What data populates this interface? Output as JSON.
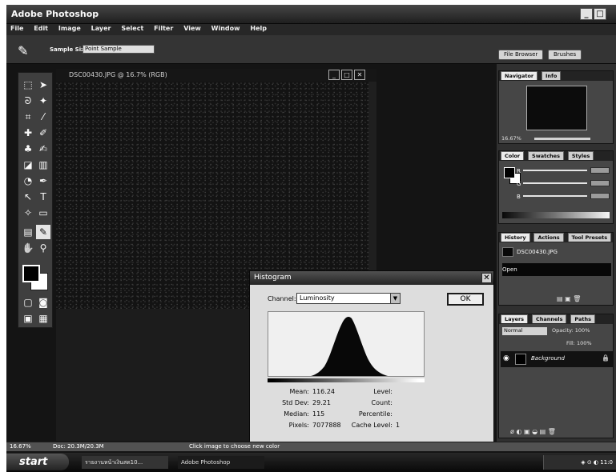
{
  "app": {
    "title": "Adobe Photoshop",
    "menu": [
      "File",
      "Edit",
      "Image",
      "Layer",
      "Select",
      "Filter",
      "View",
      "Window",
      "Help"
    ]
  },
  "options_bar": {
    "sample_size_label": "Sample Size:",
    "sample_size_value": "Point Sample",
    "file_browser_tab": "File Browser",
    "brushes_tab": "Brushes"
  },
  "document": {
    "title": "DSC00430.JPG @ 16.7% (RGB)"
  },
  "histogram": {
    "title": "Histogram",
    "channel_label": "Channel:",
    "channel_value": "Luminosity",
    "ok_label": "OK",
    "mean_label": "Mean:",
    "mean_value": "116.24",
    "stddev_label": "Std Dev:",
    "stddev_value": "29.21",
    "median_label": "Median:",
    "median_value": "115",
    "pixels_label": "Pixels:",
    "pixels_value": "7077888",
    "level_label": "Level:",
    "count_label": "Count:",
    "percentile_label": "Percentile:",
    "cache_label": "Cache Level:",
    "cache_value": "1"
  },
  "palettes": {
    "navigator_tabs": [
      "Navigator",
      "Info"
    ],
    "navigator_zoom": "16.67%",
    "color_tabs": [
      "Color",
      "Swatches",
      "Styles"
    ],
    "color_channels": [
      "R",
      "G",
      "B"
    ],
    "history_tabs": [
      "History",
      "Actions",
      "Tool Presets"
    ],
    "history_items": [
      "DSC00430.JPG",
      "Open"
    ],
    "layers_tabs": [
      "Layers",
      "Channels",
      "Paths"
    ],
    "blend_mode": "Normal",
    "opacity": "Opacity: 100%",
    "fill": "Fill: 100%",
    "layer_name": "Background"
  },
  "status": {
    "zoom": "16.67%",
    "doc_size": "Doc: 20.3M/20.3M",
    "hint": "Click image to choose new color"
  },
  "taskbar": {
    "start_label": "start",
    "task_1": "รายงานหน้าเงินสด10...",
    "task_2": "Adobe Photoshop",
    "clock": "11:0"
  }
}
